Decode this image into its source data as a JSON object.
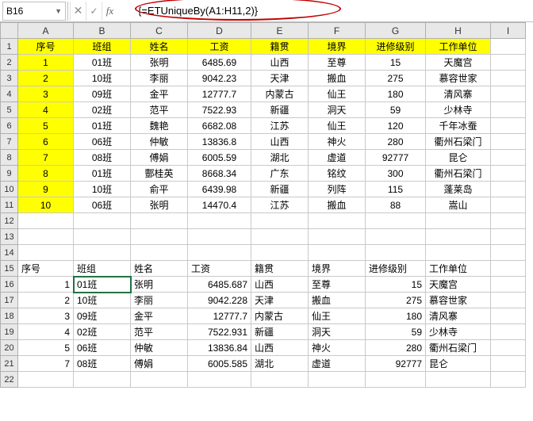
{
  "formula_bar": {
    "cell_ref": "B16",
    "formula": "{=ETUniqueBy(A1:H11,2)}",
    "cancel_icon": "✕",
    "accept_icon": "✓",
    "fx_label": "fx"
  },
  "columns": [
    "A",
    "B",
    "C",
    "D",
    "E",
    "F",
    "G",
    "H",
    "I"
  ],
  "row_numbers": [
    "1",
    "2",
    "3",
    "4",
    "5",
    "6",
    "7",
    "8",
    "9",
    "10",
    "11",
    "12",
    "13",
    "14",
    "15",
    "16",
    "17",
    "18",
    "19",
    "20",
    "21",
    "22"
  ],
  "table1": {
    "headers": [
      "序号",
      "班组",
      "姓名",
      "工资",
      "籍贯",
      "境界",
      "进修级别",
      "工作单位"
    ],
    "rows": [
      [
        "1",
        "01班",
        "张明",
        "6485.69",
        "山西",
        "至尊",
        "15",
        "天魔宫"
      ],
      [
        "2",
        "10班",
        "李丽",
        "9042.23",
        "天津",
        "搬血",
        "275",
        "慕容世家"
      ],
      [
        "3",
        "09班",
        "金平",
        "12777.7",
        "内蒙古",
        "仙王",
        "180",
        "清风寨"
      ],
      [
        "4",
        "02班",
        "范平",
        "7522.93",
        "新疆",
        "洞天",
        "59",
        "少林寺"
      ],
      [
        "5",
        "01班",
        "魏艳",
        "6682.08",
        "江苏",
        "仙王",
        "120",
        "千年冰蚕"
      ],
      [
        "6",
        "06班",
        "仲敏",
        "13836.8",
        "山西",
        "神火",
        "280",
        "衢州石梁门"
      ],
      [
        "7",
        "08班",
        "傅娟",
        "6005.59",
        "湖北",
        "虚道",
        "92777",
        "昆仑"
      ],
      [
        "8",
        "01班",
        "酆桂英",
        "8668.34",
        "广东",
        "铭纹",
        "300",
        "衢州石梁门"
      ],
      [
        "9",
        "10班",
        "俞平",
        "6439.98",
        "新疆",
        "列阵",
        "115",
        "蓬莱岛"
      ],
      [
        "10",
        "06班",
        "张明",
        "14470.4",
        "江苏",
        "搬血",
        "88",
        "嵩山"
      ]
    ]
  },
  "table2": {
    "headers": [
      "序号",
      "班组",
      "姓名",
      "工资",
      "籍贯",
      "境界",
      "进修级别",
      "工作单位"
    ],
    "rows": [
      [
        "1",
        "01班",
        "张明",
        "6485.687",
        "山西",
        "至尊",
        "15",
        "天魔宫"
      ],
      [
        "2",
        "10班",
        "李丽",
        "9042.228",
        "天津",
        "搬血",
        "275",
        "慕容世家"
      ],
      [
        "3",
        "09班",
        "金平",
        "12777.7",
        "内蒙古",
        "仙王",
        "180",
        "清风寨"
      ],
      [
        "4",
        "02班",
        "范平",
        "7522.931",
        "新疆",
        "洞天",
        "59",
        "少林寺"
      ],
      [
        "5",
        "06班",
        "仲敏",
        "13836.84",
        "山西",
        "神火",
        "280",
        "衢州石梁门"
      ],
      [
        "7",
        "08班",
        "傅娟",
        "6005.585",
        "湖北",
        "虚道",
        "92777",
        "昆仑"
      ]
    ]
  }
}
